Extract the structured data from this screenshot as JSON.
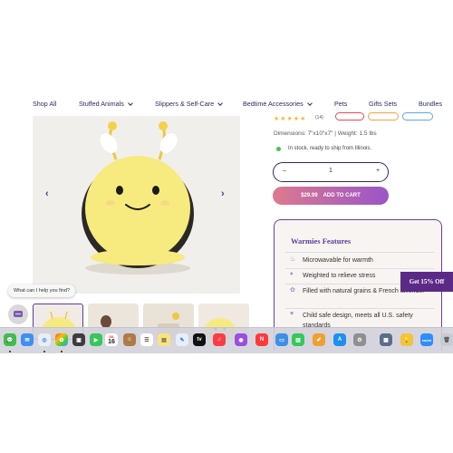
{
  "nav": {
    "items": [
      {
        "label": "Shop All",
        "chevron": false
      },
      {
        "label": "Stuffed Animals",
        "chevron": true
      },
      {
        "label": "Slippers & Self-Care",
        "chevron": true
      },
      {
        "label": "Bedtime Accessories",
        "chevron": true
      },
      {
        "label": "Pets",
        "chevron": false
      },
      {
        "label": "Gifts Sets",
        "chevron": false
      },
      {
        "label": "Bundles",
        "chevron": false
      }
    ]
  },
  "gallery": {
    "prev_arrow": "‹",
    "next_arrow": "›"
  },
  "product": {
    "stars": "★★★★★",
    "review_count": "(14)",
    "dimensions": "Dimensions: 7\"x10\"x7\" | Weight: 1.5 lbs",
    "stock": "In stock, ready to ship from Illinois.",
    "quantity": "1",
    "qty_minus": "–",
    "qty_plus": "+",
    "price": "$29.99",
    "add_to_cart": "ADD TO CART"
  },
  "features": {
    "title": "Warmies Features",
    "items": [
      {
        "icon": "♨",
        "text": "Microwavable for warmth"
      },
      {
        "icon": "♦",
        "text": "Weighted to relieve stress"
      },
      {
        "icon": "✿",
        "text": "Filled with natural grains & French lavender"
      },
      {
        "icon": "♥",
        "text": "Child safe design, meets all U.S. safety standards"
      }
    ]
  },
  "offer": {
    "label": "Get 15% Off"
  },
  "chat": {
    "prompt": "What can I help you find?"
  },
  "dock": {
    "calendar_day": "16",
    "calendar_month": "JUL",
    "badge_messages": "24",
    "badge_mail": "99",
    "badge_settings": "1",
    "tv_label": "tv",
    "zoom_label": "zoom"
  }
}
